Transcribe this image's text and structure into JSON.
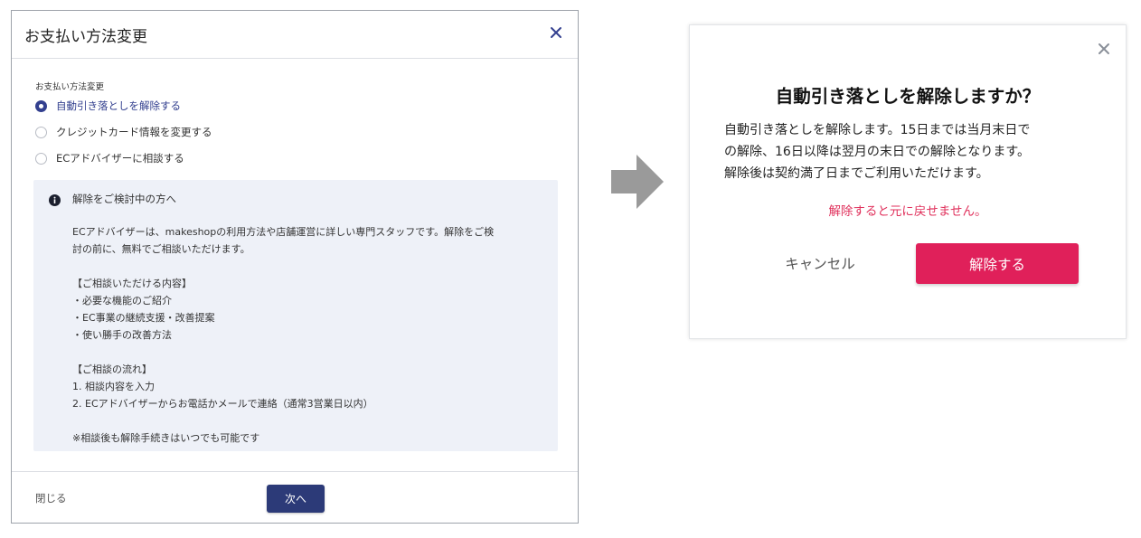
{
  "payment_modal": {
    "title": "お支払い方法変更",
    "section_label": "お支払い方法変更",
    "options": [
      {
        "label": "自動引き落としを解除する",
        "selected": true
      },
      {
        "label": "クレジットカード情報を変更する",
        "selected": false
      },
      {
        "label": "ECアドバイザーに相談する",
        "selected": false
      }
    ],
    "info": {
      "title": "解除をご検討中の方へ",
      "intro_line1": "ECアドバイザーは、makeshopの利用方法や店舗運営に詳しい専門スタッフです。解除をご検",
      "intro_line2": "討の前に、無料でご相談いただけます。",
      "consult_heading": "【ご相談いただける内容】",
      "consult_items": [
        "・必要な機能のご紹介",
        "・EC事業の継続支援・改善提案",
        "・使い勝手の改善方法"
      ],
      "flow_heading": "【ご相談の流れ】",
      "flow_items": [
        "1. 相談内容を入力",
        "2. ECアドバイザーからお電話かメールで連絡（通常3営業日以内）"
      ],
      "note": "※相談後も解除手続きはいつでも可能です"
    },
    "close_label": "閉じる",
    "next_label": "次へ",
    "accent_color": "#33408f"
  },
  "confirm_modal": {
    "title": "自動引き落としを解除しますか？",
    "body_lines": [
      "自動引き落としを解除します。15日までは当月末日で",
      "の解除、16日以降は翌月の末日での解除となります。",
      "解除後は契約満了日までご利用いただけます。"
    ],
    "warning": "解除すると元に戻せません。",
    "cancel_label": "キャンセル",
    "confirm_label": "解除する",
    "confirm_color": "#e0205a"
  },
  "icons": {
    "close": "close-icon",
    "info": "info-icon",
    "arrow": "arrow-right-icon"
  }
}
